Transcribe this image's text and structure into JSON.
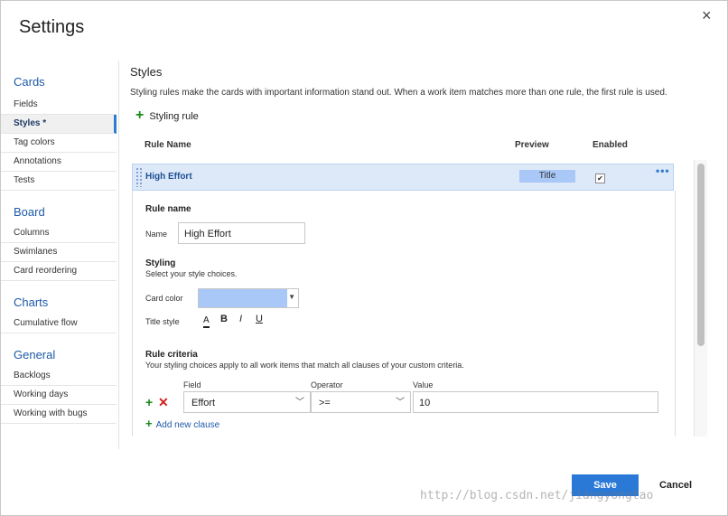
{
  "dialog": {
    "title": "Settings",
    "close_glyph": "×"
  },
  "nav": {
    "groups": [
      {
        "label": "Cards",
        "items": [
          "Fields",
          "Styles *",
          "Tag colors",
          "Annotations",
          "Tests"
        ]
      },
      {
        "label": "Board",
        "items": [
          "Columns",
          "Swimlanes",
          "Card reordering"
        ]
      },
      {
        "label": "Charts",
        "items": [
          "Cumulative flow"
        ]
      },
      {
        "label": "General",
        "items": [
          "Backlogs",
          "Working days",
          "Working with bugs"
        ]
      }
    ],
    "selected": "Styles *"
  },
  "styles": {
    "title": "Styles",
    "description": "Styling rules make the cards with important information stand out. When a work item matches more than one rule, the first rule is used.",
    "add_rule_label": "Styling rule",
    "columns": {
      "rule_name": "Rule Name",
      "preview": "Preview",
      "enabled": "Enabled"
    },
    "rule": {
      "name": "High Effort",
      "preview_label": "Title",
      "enabled": true,
      "enabled_glyph": "✔",
      "more_glyph": "•••"
    }
  },
  "editor": {
    "rule_name_heading": "Rule name",
    "name_label": "Name",
    "name_value": "High Effort",
    "styling_heading": "Styling",
    "styling_sub": "Select your style choices.",
    "card_color_label": "Card color",
    "card_color": "#a9c7f7",
    "title_style_label": "Title style",
    "format_buttons": {
      "color": "A",
      "bold": "B",
      "italic": "I",
      "underline": "U"
    },
    "criteria_heading": "Rule criteria",
    "criteria_sub": "Your styling choices apply to all work items that match all clauses of your custom criteria.",
    "clause_headers": {
      "field": "Field",
      "operator": "Operator",
      "value": "Value"
    },
    "clause": {
      "field": "Effort",
      "operator": ">=",
      "value": "10"
    },
    "add_clause_label": "Add new clause"
  },
  "footer": {
    "save": "Save",
    "cancel": "Cancel"
  },
  "watermark": "http://blog.csdn.net/jiangyongtao",
  "colors": {
    "accent": "#2b79d6",
    "selected_row": "#dde9f8",
    "swatch": "#a9c7f7",
    "add_green": "#1a8a1a",
    "remove_red": "#d02020"
  }
}
